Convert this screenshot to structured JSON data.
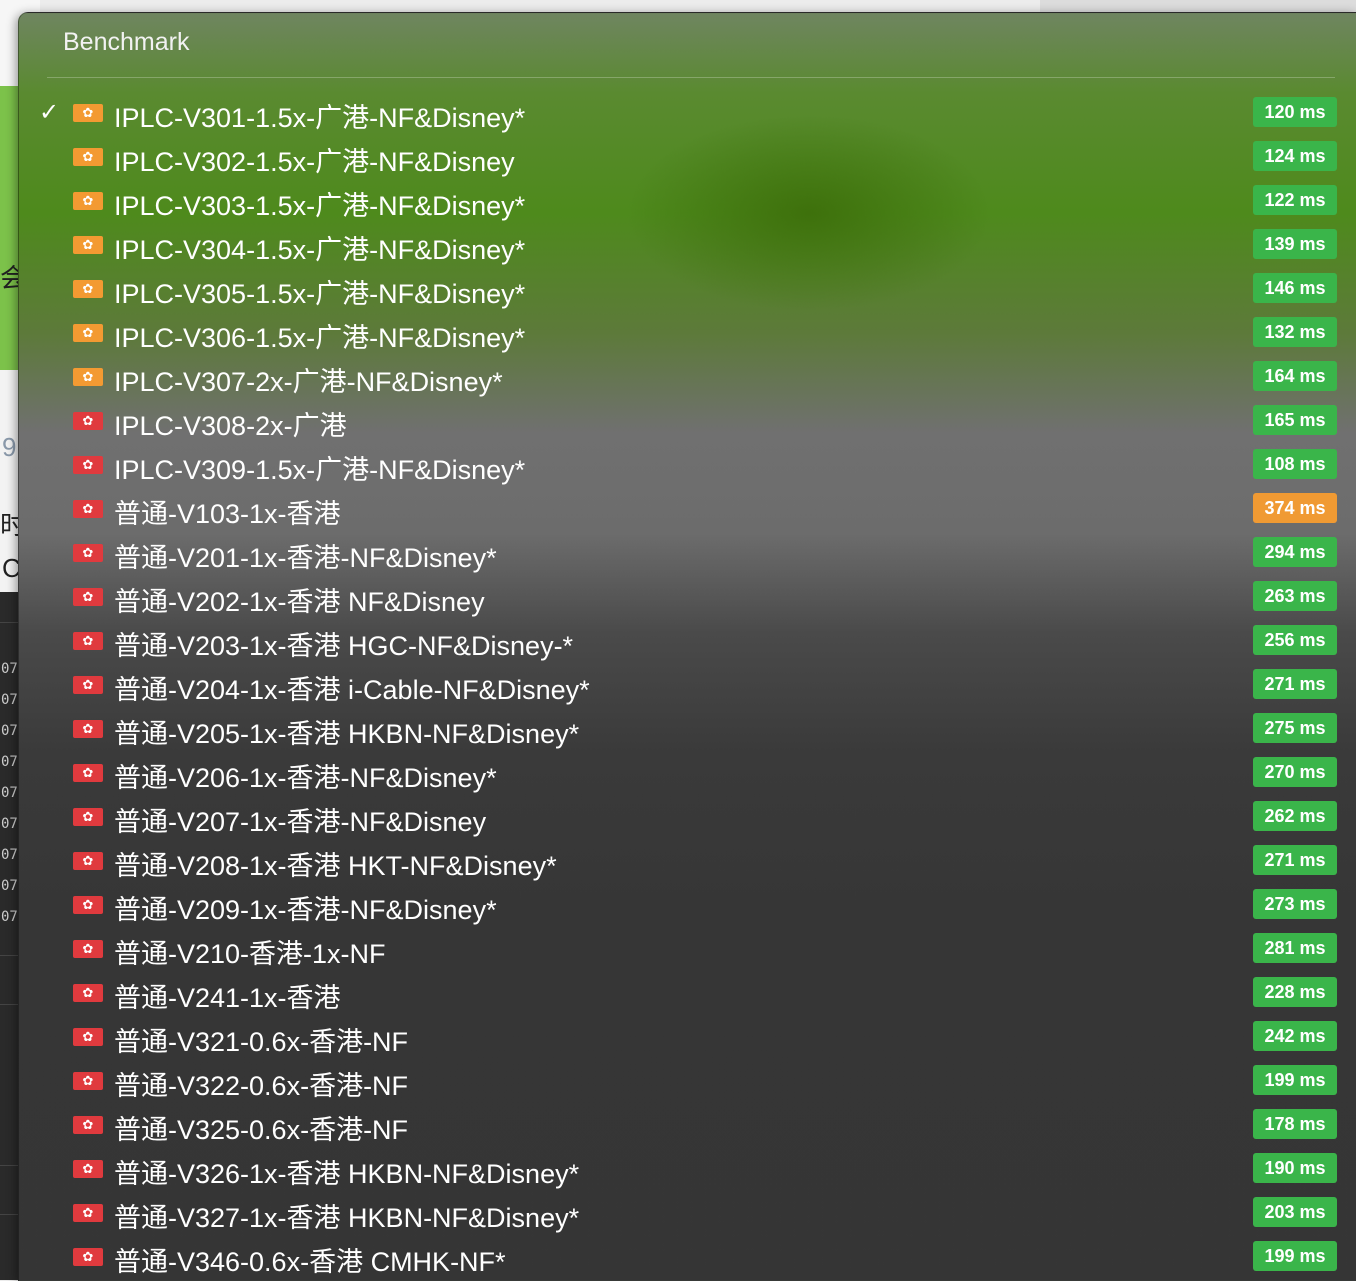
{
  "menu": {
    "title": "Benchmark",
    "items": [
      {
        "label": "IPLC-V301-1.5x-广港-NF&Disney*",
        "latency": "120 ms",
        "flag": "guangdong-flag-icon",
        "selected": true
      },
      {
        "label": "IPLC-V302-1.5x-广港-NF&Disney",
        "latency": "124 ms",
        "flag": "guangdong-flag-icon"
      },
      {
        "label": "IPLC-V303-1.5x-广港-NF&Disney*",
        "latency": "122 ms",
        "flag": "guangdong-flag-icon"
      },
      {
        "label": "IPLC-V304-1.5x-广港-NF&Disney*",
        "latency": "139 ms",
        "flag": "guangdong-flag-icon"
      },
      {
        "label": "IPLC-V305-1.5x-广港-NF&Disney*",
        "latency": "146 ms",
        "flag": "guangdong-flag-icon"
      },
      {
        "label": "IPLC-V306-1.5x-广港-NF&Disney*",
        "latency": "132 ms",
        "flag": "guangdong-flag-icon"
      },
      {
        "label": "IPLC-V307-2x-广港-NF&Disney*",
        "latency": "164 ms",
        "flag": "guangdong-flag-icon"
      },
      {
        "label": "IPLC-V308-2x-广港",
        "latency": "165 ms",
        "flag": "hong-kong-flag-icon"
      },
      {
        "label": "IPLC-V309-1.5x-广港-NF&Disney*",
        "latency": "108 ms",
        "flag": "hong-kong-flag-icon"
      },
      {
        "label": "普通-V103-1x-香港",
        "latency": "374 ms",
        "flag": "hong-kong-flag-icon",
        "warn": true
      },
      {
        "label": "普通-V201-1x-香港-NF&Disney*",
        "latency": "294 ms",
        "flag": "hong-kong-flag-icon"
      },
      {
        "label": "普通-V202-1x-香港 NF&Disney",
        "latency": "263 ms",
        "flag": "hong-kong-flag-icon"
      },
      {
        "label": "普通-V203-1x-香港 HGC-NF&Disney-*",
        "latency": "256 ms",
        "flag": "hong-kong-flag-icon"
      },
      {
        "label": "普通-V204-1x-香港 i-Cable-NF&Disney*",
        "latency": "271 ms",
        "flag": "hong-kong-flag-icon"
      },
      {
        "label": "普通-V205-1x-香港 HKBN-NF&Disney*",
        "latency": "275 ms",
        "flag": "hong-kong-flag-icon"
      },
      {
        "label": "普通-V206-1x-香港-NF&Disney*",
        "latency": "270 ms",
        "flag": "hong-kong-flag-icon"
      },
      {
        "label": "普通-V207-1x-香港-NF&Disney",
        "latency": "262 ms",
        "flag": "hong-kong-flag-icon"
      },
      {
        "label": "普通-V208-1x-香港 HKT-NF&Disney*",
        "latency": "271 ms",
        "flag": "hong-kong-flag-icon"
      },
      {
        "label": "普通-V209-1x-香港-NF&Disney*",
        "latency": "273 ms",
        "flag": "hong-kong-flag-icon"
      },
      {
        "label": "普通-V210-香港-1x-NF",
        "latency": "281 ms",
        "flag": "hong-kong-flag-icon"
      },
      {
        "label": "普通-V241-1x-香港",
        "latency": "228 ms",
        "flag": "hong-kong-flag-icon"
      },
      {
        "label": "普通-V321-0.6x-香港-NF",
        "latency": "242 ms",
        "flag": "hong-kong-flag-icon"
      },
      {
        "label": "普通-V322-0.6x-香港-NF",
        "latency": "199 ms",
        "flag": "hong-kong-flag-icon"
      },
      {
        "label": "普通-V325-0.6x-香港-NF",
        "latency": "178 ms",
        "flag": "hong-kong-flag-icon"
      },
      {
        "label": "普通-V326-1x-香港 HKBN-NF&Disney*",
        "latency": "190 ms",
        "flag": "hong-kong-flag-icon"
      },
      {
        "label": "普通-V327-1x-香港 HKBN-NF&Disney*",
        "latency": "203 ms",
        "flag": "hong-kong-flag-icon"
      },
      {
        "label": "普通-V346-0.6x-香港 CMHK-NF*",
        "latency": "199 ms",
        "flag": "hong-kong-flag-icon"
      }
    ]
  },
  "background": {
    "green_text": "会",
    "light_text_1": "9",
    "light_text_2": "时",
    "light_text_3": "C",
    "row_numbers": [
      "07",
      "07",
      "07",
      "07",
      "07",
      "07",
      "07",
      "07",
      "07"
    ]
  },
  "colors": {
    "badge_ok": "#3ab54a",
    "badge_warn": "#f09a33",
    "hk_flag": "#e03a3e",
    "gd_flag": "#f39a32"
  }
}
